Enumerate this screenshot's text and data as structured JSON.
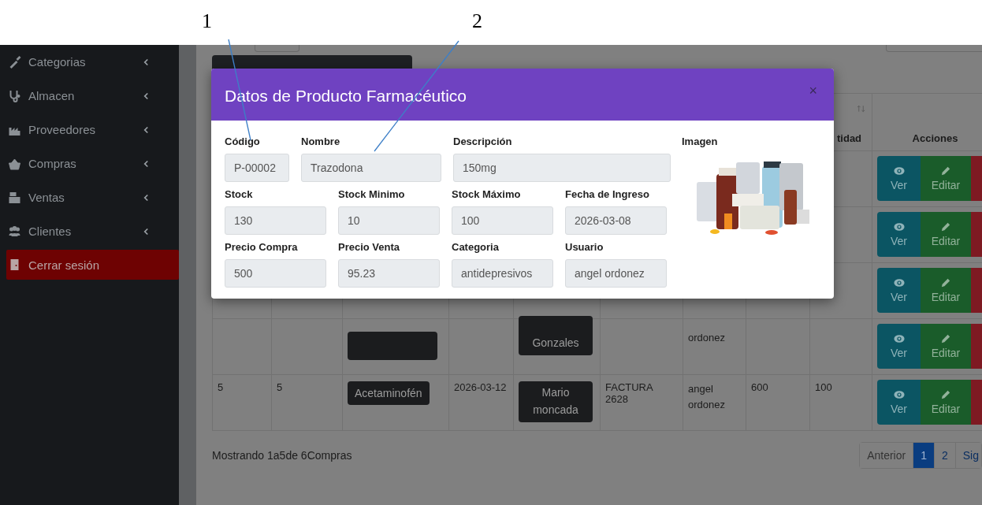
{
  "annotations": [
    {
      "label": "1"
    },
    {
      "label": "2"
    }
  ],
  "sidebar": {
    "items": [
      {
        "label": "Categorias",
        "kind": "menu"
      },
      {
        "label": "Almacen",
        "kind": "menu"
      },
      {
        "label": "Proveedores",
        "kind": "menu"
      },
      {
        "label": "Compras",
        "kind": "menu"
      },
      {
        "label": "Ventas",
        "kind": "menu"
      },
      {
        "label": "Clientes",
        "kind": "menu"
      },
      {
        "label": "Cerrar sesión",
        "kind": "logout"
      }
    ]
  },
  "table": {
    "quantity_header": "tidad",
    "actions_header": "Acciones",
    "rows": [
      {
        "actions": [
          {
            "label": "Ver",
            "kind": "view"
          },
          {
            "label": "Editar",
            "kind": "edit"
          },
          {
            "kind": "delete"
          }
        ]
      },
      {
        "actions": [
          {
            "label": "Ver",
            "kind": "view"
          },
          {
            "label": "Editar",
            "kind": "edit"
          },
          {
            "kind": "delete"
          }
        ]
      },
      {
        "actions": [
          {
            "label": "Ver",
            "kind": "view"
          },
          {
            "label": "Editar",
            "kind": "edit"
          },
          {
            "kind": "delete"
          }
        ]
      },
      {
        "product_covered": true,
        "supplier": "Gonzales",
        "user": "ordonez",
        "actions": [
          {
            "label": "Ver",
            "kind": "view"
          },
          {
            "label": "Editar",
            "kind": "edit"
          },
          {
            "kind": "delete"
          }
        ]
      },
      {
        "id": "5",
        "number": "5",
        "product": "Acetaminofén",
        "date": "2026-03-12",
        "supplier": "Mario moncada",
        "invoice": "FACTURA 2628",
        "user": "angel ordonez",
        "price": "600",
        "quantity": "100",
        "actions": [
          {
            "label": "Ver",
            "kind": "view"
          },
          {
            "label": "Editar",
            "kind": "edit"
          },
          {
            "kind": "delete"
          }
        ]
      }
    ],
    "summary": "Mostrando 1a5de 6Compras",
    "pagination": [
      {
        "label": "Anterior",
        "selected": false
      },
      {
        "label": "1",
        "selected": true
      },
      {
        "label": "2",
        "selected": false
      },
      {
        "label": "Sig",
        "selected": false
      }
    ]
  },
  "modal": {
    "title": "Datos de Producto Farmacéutico",
    "close": "×",
    "rows": [
      [
        {
          "label": "Código",
          "value": "P-00002"
        },
        {
          "label": "Nombre",
          "value": "Trazodona"
        },
        {
          "label": "Descripción",
          "value": "150mg"
        }
      ],
      [
        {
          "label": "Stock",
          "value": "130"
        },
        {
          "label": "Stock Minimo",
          "value": "10"
        },
        {
          "label": "Stock Máximo",
          "value": "100"
        },
        {
          "label": "Fecha de Ingreso",
          "value": "2026-03-08"
        }
      ],
      [
        {
          "label": "Precio Compra",
          "value": "500"
        },
        {
          "label": "Precio Venta",
          "value": "95.23"
        },
        {
          "label": "Categoria",
          "value": "antidepresivos"
        },
        {
          "label": "Usuario",
          "value": "angel ordonez"
        }
      ]
    ],
    "image_label": "Imagen"
  }
}
